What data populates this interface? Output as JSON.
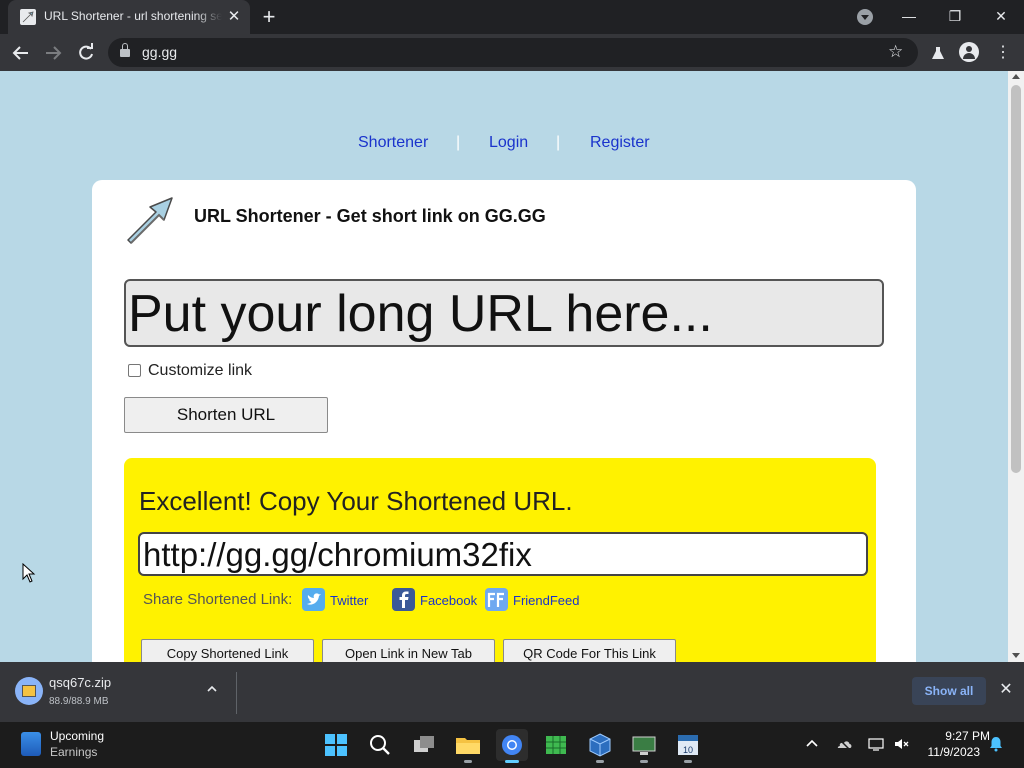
{
  "browser": {
    "tab_title": "URL Shortener - url shortening service",
    "tab_close": "✕",
    "new_tab": "+",
    "address": "gg.gg",
    "window": {
      "minimize": "—",
      "maximize": "❐",
      "close": "✕"
    }
  },
  "page": {
    "nav": {
      "shortener": "Shortener",
      "login": "Login",
      "register": "Register",
      "separator": "|"
    },
    "title": "URL Shortener - Get short link on GG.GG",
    "url_placeholder": "Put your long URL here...",
    "customize_label": "Customize link",
    "customize_checked": false,
    "shorten_button": "Shorten URL",
    "result": {
      "heading": "Excellent! Copy Your Shortened URL.",
      "short_url": "http://gg.gg/chromium32fix",
      "share_label": "Share Shortened Link:",
      "share": [
        {
          "label": "Twitter",
          "icon": "twitter-icon",
          "color": "#55acee"
        },
        {
          "label": "Facebook",
          "icon": "facebook-icon",
          "color": "#3b5998"
        },
        {
          "label": "FriendFeed",
          "icon": "friendfeed-icon",
          "color": "#6fa8f0"
        }
      ],
      "buttons": {
        "copy": "Copy Shortened Link",
        "open": "Open Link in New Tab",
        "qr": "QR Code For This Link"
      }
    }
  },
  "download": {
    "filename": "qsq67c.zip",
    "size": "88.9/88.9 MB",
    "show_all": "Show all"
  },
  "taskbar": {
    "widget_title": "Upcoming",
    "widget_subtitle": "Earnings",
    "time": "9:27 PM",
    "date": "11/9/2023"
  },
  "colors": {
    "page_bg": "#b8d8e6",
    "result_bg": "#fff200",
    "link": "#1a33cc"
  }
}
